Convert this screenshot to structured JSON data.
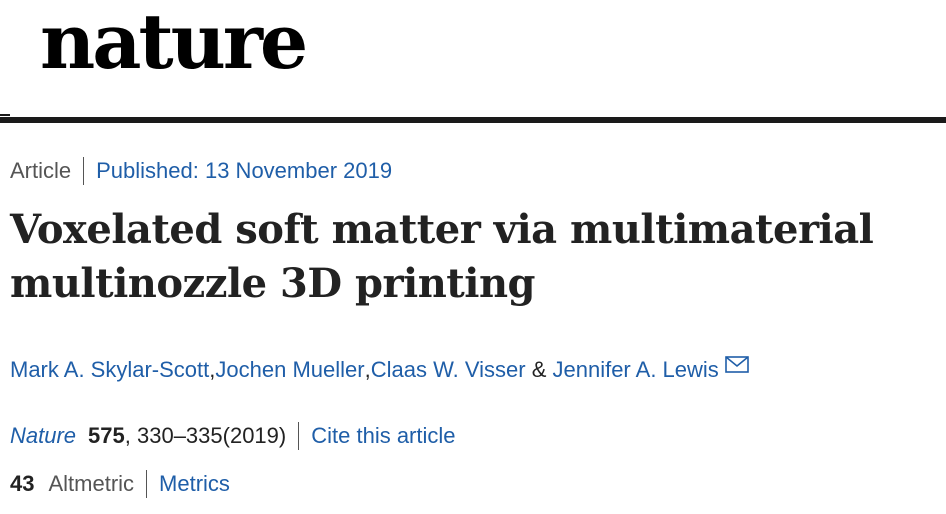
{
  "masthead": {
    "logo_text": "nature"
  },
  "article_meta": {
    "type": "Article",
    "published_label": "Published: 13 November 2019"
  },
  "article": {
    "title_line1": "Voxelated soft matter via multimaterial",
    "title_line2": "multinozzle 3D printing"
  },
  "authors": {
    "items": [
      "Mark A. Skylar-Scott",
      "Jochen Mueller",
      "Claas W. Visser",
      "Jennifer A. Lewis"
    ],
    "separator": ", ",
    "last_separator": " & ",
    "contact_icon": "envelope-icon"
  },
  "citation": {
    "journal": "Nature",
    "volume": "575",
    "pages": ", 330–335(2019)",
    "cite_link": "Cite this article"
  },
  "metrics": {
    "count": "43",
    "label": "Altmetric",
    "link": "Metrics"
  },
  "colors": {
    "link": "#1f5ea8",
    "text": "#222222",
    "muted": "#555555",
    "rule": "#1a1a1a"
  }
}
